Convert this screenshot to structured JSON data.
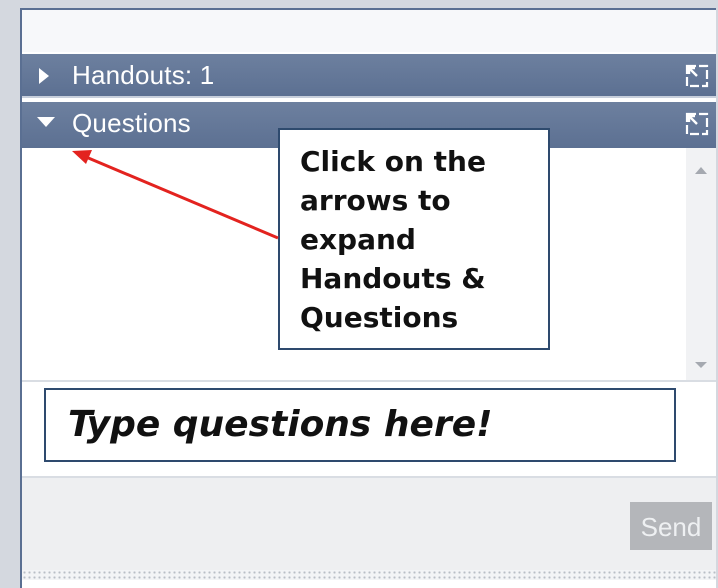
{
  "sections": {
    "handouts": {
      "label": "Handouts: 1",
      "expanded": false,
      "arrow_icon": "triangle-right-icon",
      "popout_icon": "popout-icon"
    },
    "questions": {
      "label": "Questions",
      "expanded": true,
      "arrow_icon": "triangle-down-icon",
      "popout_icon": "popout-icon"
    }
  },
  "callout": {
    "text": "Click on the\narrows to\nexpand\nHandouts &\nQuestions"
  },
  "question_input": {
    "placeholder": "Type questions here!"
  },
  "send_button": {
    "label": "Send",
    "enabled": false
  },
  "colors": {
    "header_bg": "#5f7394",
    "annotation_arrow": "#e3231f",
    "callout_border": "#2e4a6e",
    "send_disabled": "#b4b6ba"
  }
}
